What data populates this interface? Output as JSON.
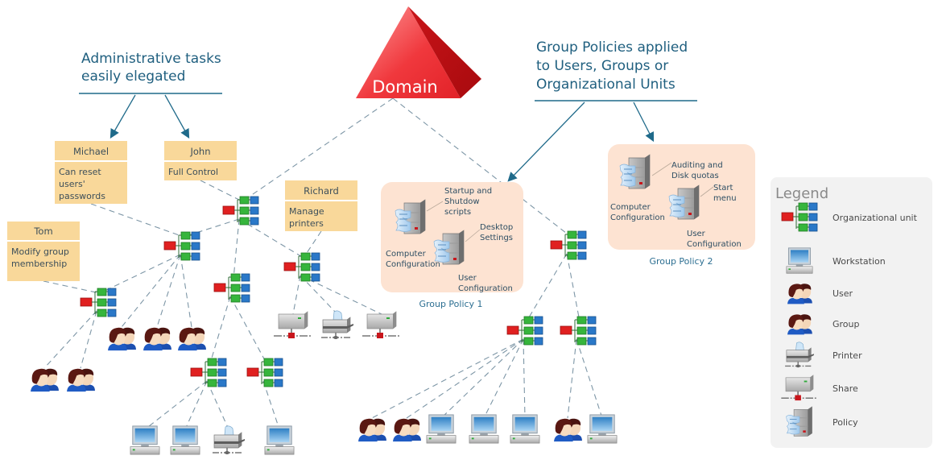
{
  "domain_node": {
    "label": "Domain"
  },
  "headings": {
    "admin": [
      "Administrative tasks",
      "easily elegated"
    ],
    "policies": [
      "Group Policies applied",
      "to Users, Groups or",
      "Organizational Units"
    ]
  },
  "delegates": [
    {
      "name": "Michael",
      "task": [
        "Can reset",
        "users'",
        "passwords"
      ]
    },
    {
      "name": "John",
      "task": [
        "Full Control"
      ]
    },
    {
      "name": "Richard",
      "task": [
        "Manage",
        "printers"
      ]
    },
    {
      "name": "Tom",
      "task": [
        "Modify group",
        "membership"
      ]
    }
  ],
  "group_policies": [
    {
      "caption": "Group Policy 1",
      "computer_label": [
        "Computer",
        "Configuration"
      ],
      "computer_setting": [
        "Startup and",
        "Shutdow",
        "scripts"
      ],
      "user_label": [
        "User",
        "Configuration"
      ],
      "user_setting": [
        "Desktop",
        "Settings"
      ]
    },
    {
      "caption": "Group Policy 2",
      "computer_label": [
        "Computer",
        "Configuration"
      ],
      "computer_setting": [
        "Auditing and",
        "Disk quotas"
      ],
      "user_label": [
        "User",
        "Configuration"
      ],
      "user_setting": [
        "Start",
        "menu"
      ]
    }
  ],
  "legend": {
    "title": "Legend",
    "items": [
      {
        "icon": "ou",
        "label": "Organizational unit"
      },
      {
        "icon": "workstation",
        "label": "Workstation"
      },
      {
        "icon": "user",
        "label": "User"
      },
      {
        "icon": "group",
        "label": "Group"
      },
      {
        "icon": "printer",
        "label": "Printer"
      },
      {
        "icon": "share",
        "label": "Share"
      },
      {
        "icon": "policy",
        "label": "Policy"
      }
    ]
  },
  "colors": {
    "domain": "#e8252b",
    "ou_red": "#e02020",
    "ou_green": "#34b43a",
    "ou_blue": "#2a78c8",
    "note_fill": "#f9d89a",
    "gp_fill": "#fde3d2",
    "legend_fill": "#f2f2f2",
    "heading_text": "#1f5f7f"
  },
  "network": {
    "nodes": [
      {
        "id": "ou_john",
        "type": "ou"
      },
      {
        "id": "ou_michael",
        "type": "ou"
      },
      {
        "id": "ou_tom",
        "type": "ou"
      },
      {
        "id": "ou_mid",
        "type": "ou"
      },
      {
        "id": "ou_richard",
        "type": "ou"
      },
      {
        "id": "ou_ws_a",
        "type": "ou"
      },
      {
        "id": "ou_ws_b",
        "type": "ou"
      },
      {
        "id": "ou_right",
        "type": "ou"
      },
      {
        "id": "ou_right_a",
        "type": "ou"
      },
      {
        "id": "ou_right_b",
        "type": "ou"
      },
      {
        "id": "grp_1",
        "type": "group"
      },
      {
        "id": "grp_2",
        "type": "group"
      },
      {
        "id": "grp_3",
        "type": "group"
      },
      {
        "id": "usr_1",
        "type": "user"
      },
      {
        "id": "usr_2",
        "type": "user"
      },
      {
        "id": "share_1",
        "type": "share"
      },
      {
        "id": "printer_1",
        "type": "printer"
      },
      {
        "id": "share_2",
        "type": "share"
      },
      {
        "id": "ws_1",
        "type": "workstation"
      },
      {
        "id": "ws_2",
        "type": "workstation"
      },
      {
        "id": "printer_2",
        "type": "printer"
      },
      {
        "id": "ws_3",
        "type": "workstation"
      },
      {
        "id": "usr_3",
        "type": "user"
      },
      {
        "id": "usr_4",
        "type": "user"
      },
      {
        "id": "ws_4",
        "type": "workstation"
      },
      {
        "id": "ws_5",
        "type": "workstation"
      },
      {
        "id": "ws_6",
        "type": "workstation"
      },
      {
        "id": "usr_5",
        "type": "user"
      },
      {
        "id": "ws_7",
        "type": "workstation"
      }
    ],
    "edges": [
      [
        "domain",
        "ou_john"
      ],
      [
        "domain",
        "ou_right"
      ],
      [
        "note_john",
        "ou_john"
      ],
      [
        "ou_john",
        "ou_michael"
      ],
      [
        "ou_john",
        "ou_mid"
      ],
      [
        "ou_john",
        "ou_richard"
      ],
      [
        "note_michael",
        "ou_michael"
      ],
      [
        "ou_michael",
        "ou_tom"
      ],
      [
        "ou_michael",
        "grp_1"
      ],
      [
        "ou_michael",
        "grp_2"
      ],
      [
        "ou_michael",
        "grp_3"
      ],
      [
        "note_tom",
        "ou_tom"
      ],
      [
        "ou_tom",
        "usr_1"
      ],
      [
        "ou_tom",
        "usr_2"
      ],
      [
        "ou_mid",
        "ou_ws_a"
      ],
      [
        "ou_mid",
        "ou_ws_b"
      ],
      [
        "note_richard",
        "ou_richard"
      ],
      [
        "ou_richard",
        "share_1"
      ],
      [
        "ou_richard",
        "printer_1"
      ],
      [
        "ou_richard",
        "share_2"
      ],
      [
        "ou_ws_a",
        "ws_1"
      ],
      [
        "ou_ws_a",
        "ws_2"
      ],
      [
        "ou_ws_a",
        "printer_2"
      ],
      [
        "ou_ws_b",
        "ws_3"
      ],
      [
        "ou_right",
        "ou_right_a"
      ],
      [
        "ou_right",
        "ou_right_b"
      ],
      [
        "ou_right_a",
        "usr_3"
      ],
      [
        "ou_right_a",
        "usr_4"
      ],
      [
        "ou_right_a",
        "ws_4"
      ],
      [
        "ou_right_a",
        "ws_5"
      ],
      [
        "ou_right_a",
        "ws_6"
      ],
      [
        "ou_right_b",
        "usr_5"
      ],
      [
        "ou_right_b",
        "ws_7"
      ]
    ]
  }
}
